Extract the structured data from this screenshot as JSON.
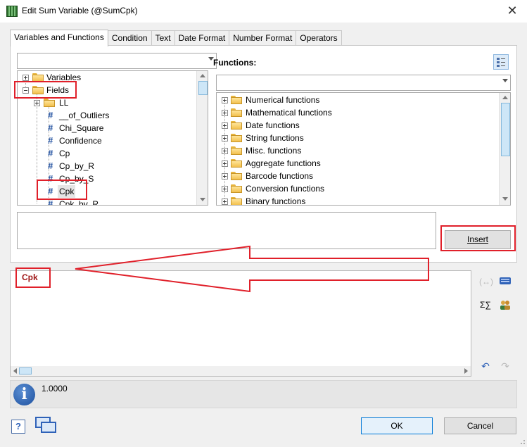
{
  "window": {
    "title": "Edit Sum Variable (@SumCpk)"
  },
  "tabs": [
    {
      "label": "Variables and Functions",
      "active": true
    },
    {
      "label": "Condition"
    },
    {
      "label": "Text"
    },
    {
      "label": "Date Format"
    },
    {
      "label": "Number Format"
    },
    {
      "label": "Operators"
    }
  ],
  "left_tree": {
    "filter_value": "",
    "items": [
      {
        "label": "Variables"
      },
      {
        "label": "Fields"
      },
      {
        "label": "LL"
      },
      {
        "label": "__of_Outliers"
      },
      {
        "label": "Chi_Square"
      },
      {
        "label": "Confidence"
      },
      {
        "label": "Cp"
      },
      {
        "label": "Cp_by_R"
      },
      {
        "label": "Cp_by_S"
      },
      {
        "label": "Cpk"
      },
      {
        "label": "Cpk_by_R"
      }
    ]
  },
  "functions": {
    "label": "Functions:",
    "filter_value": "",
    "items": [
      "Numerical functions",
      "Mathematical functions",
      "Date functions",
      "String functions",
      "Misc. functions",
      "Aggregate functions",
      "Barcode functions",
      "Conversion functions",
      "Binary functions"
    ]
  },
  "insert_button": "Insert",
  "editor": {
    "expression": "Cpk"
  },
  "side_icons": {
    "sum_icon": "Σ∑"
  },
  "status": {
    "value": "1.0000"
  },
  "buttons": {
    "ok": "OK",
    "cancel": "Cancel"
  },
  "colors": {
    "highlight_red": "#e0202a",
    "expression_text": "#a01818",
    "ok_border": "#0078d7"
  }
}
